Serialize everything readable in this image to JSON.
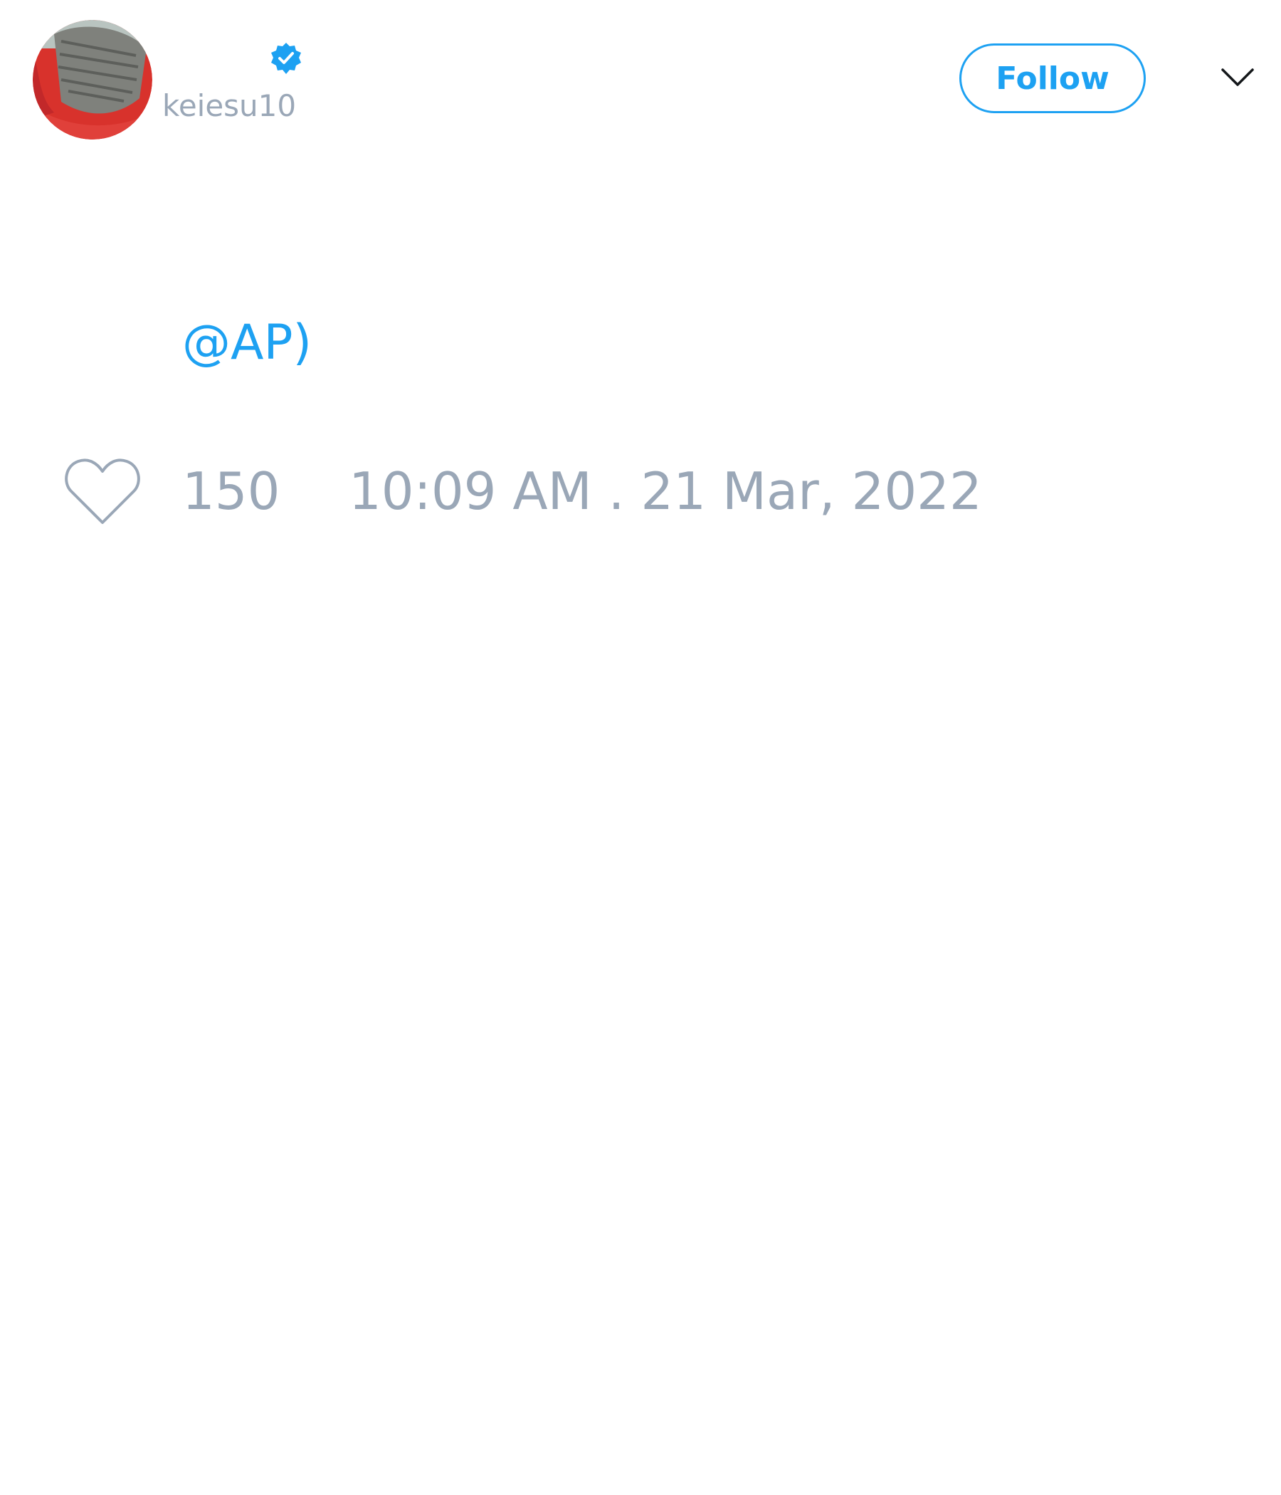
{
  "tweet": {
    "author": {
      "handle": "keiesu10",
      "avatar_icon": "user-avatar-photo",
      "verified_icon": "verified-badge-icon"
    },
    "follow_label": "Follow",
    "menu_icon": "chevron-down-icon",
    "text": {
      "mention": "@AP)"
    },
    "likes": {
      "icon": "heart-icon",
      "count": "150"
    },
    "timestamp": "10:09 AM . 21 Mar, 2022"
  },
  "colors": {
    "accent": "#1da1f2",
    "muted_text": "#9aa7b7",
    "background": "#ffffff"
  }
}
